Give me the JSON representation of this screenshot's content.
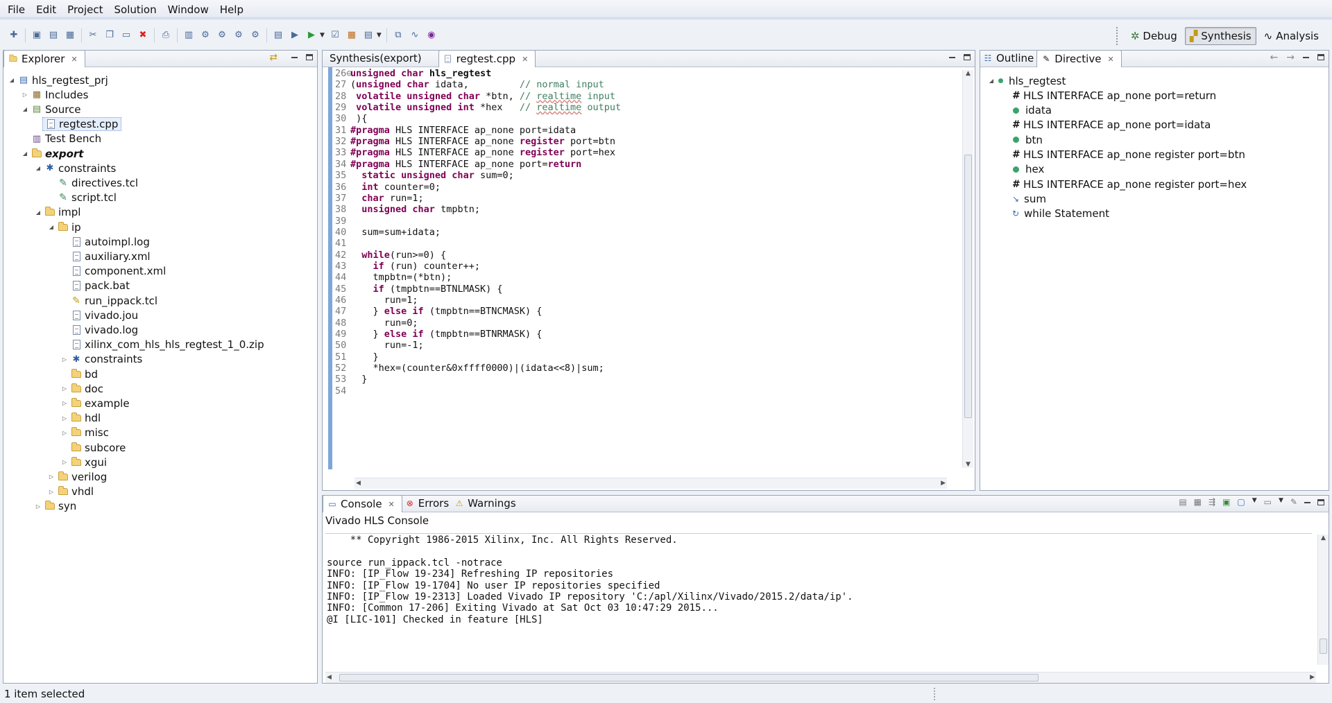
{
  "menu": [
    "File",
    "Edit",
    "Project",
    "Solution",
    "Window",
    "Help"
  ],
  "perspectives": {
    "debug": "Debug",
    "synthesis": "Synthesis",
    "analysis": "Analysis"
  },
  "explorer": {
    "tab": "Explorer",
    "items": [
      {
        "label": "hls_regtest_prj"
      },
      {
        "label": "Includes"
      },
      {
        "label": "Source"
      },
      {
        "label": "regtest.cpp"
      },
      {
        "label": "Test Bench"
      },
      {
        "label": "export"
      },
      {
        "label": "constraints"
      },
      {
        "label": "directives.tcl"
      },
      {
        "label": "script.tcl"
      },
      {
        "label": "impl"
      },
      {
        "label": "ip"
      },
      {
        "label": "autoimpl.log"
      },
      {
        "label": "auxiliary.xml"
      },
      {
        "label": "component.xml"
      },
      {
        "label": "pack.bat"
      },
      {
        "label": "run_ippack.tcl"
      },
      {
        "label": "vivado.jou"
      },
      {
        "label": "vivado.log"
      },
      {
        "label": "xilinx_com_hls_hls_regtest_1_0.zip"
      },
      {
        "label": "constraints"
      },
      {
        "label": "bd"
      },
      {
        "label": "doc"
      },
      {
        "label": "example"
      },
      {
        "label": "hdl"
      },
      {
        "label": "misc"
      },
      {
        "label": "subcore"
      },
      {
        "label": "xgui"
      },
      {
        "label": "verilog"
      },
      {
        "label": "vhdl"
      },
      {
        "label": "syn"
      }
    ]
  },
  "editor": {
    "tabs": [
      "Synthesis(export)",
      "regtest.cpp"
    ],
    "lines": [
      {
        "n": "26",
        "html": "<span class=\"kw\">unsigned char</span> <span class=\"bold\">hls_regtest</span>"
      },
      {
        "n": "27",
        "html": "(<span class=\"kw\">unsigned char</span> idata,         <span class=\"cm\">// normal input</span>"
      },
      {
        "n": "28",
        "html": " <span class=\"kw\">volatile unsigned char</span> *btn, <span class=\"cm\">// <span class=\"sq\">realtime</span> input</span>"
      },
      {
        "n": "29",
        "html": " <span class=\"kw\">volatile unsigned int</span> *hex   <span class=\"cm\">// <span class=\"sq\">realtime</span> output</span>"
      },
      {
        "n": "30",
        "html": " ){"
      },
      {
        "n": "31",
        "html": "<span class=\"kw\">#pragma</span> HLS INTERFACE ap_none port=idata"
      },
      {
        "n": "32",
        "html": "<span class=\"kw\">#pragma</span> HLS INTERFACE ap_none <span class=\"kw\">register</span> port=btn"
      },
      {
        "n": "33",
        "html": "<span class=\"kw\">#pragma</span> HLS INTERFACE ap_none <span class=\"kw\">register</span> port=hex"
      },
      {
        "n": "34",
        "html": "<span class=\"kw\">#pragma</span> HLS INTERFACE ap_none port=<span class=\"kw\">return</span>"
      },
      {
        "n": "35",
        "html": "  <span class=\"kw\">static unsigned char</span> sum=0;"
      },
      {
        "n": "36",
        "html": "  <span class=\"kw\">int</span> counter=0;"
      },
      {
        "n": "37",
        "html": "  <span class=\"kw\">char</span> run=1;"
      },
      {
        "n": "38",
        "html": "  <span class=\"kw\">unsigned char</span> tmpbtn;"
      },
      {
        "n": "39",
        "html": ""
      },
      {
        "n": "40",
        "html": "  sum=sum+idata;"
      },
      {
        "n": "41",
        "html": ""
      },
      {
        "n": "42",
        "html": "  <span class=\"kw\">while</span>(run>=0) {"
      },
      {
        "n": "43",
        "html": "    <span class=\"kw\">if</span> (run) counter++;"
      },
      {
        "n": "44",
        "html": "    tmpbtn=(*btn);"
      },
      {
        "n": "45",
        "html": "    <span class=\"kw\">if</span> (tmpbtn==BTNLMASK) {"
      },
      {
        "n": "46",
        "html": "      run=1;"
      },
      {
        "n": "47",
        "html": "    } <span class=\"kw\">else if</span> (tmpbtn==BTNCMASK) {"
      },
      {
        "n": "48",
        "html": "      run=0;"
      },
      {
        "n": "49",
        "html": "    } <span class=\"kw\">else if</span> (tmpbtn==BTNRMASK) {"
      },
      {
        "n": "50",
        "html": "      run=-1;"
      },
      {
        "n": "51",
        "html": "    }"
      },
      {
        "n": "52",
        "html": "    *hex=(counter&amp;0xffff0000)|(idata&lt;&lt;8)|sum;"
      },
      {
        "n": "53",
        "html": "  }"
      },
      {
        "n": "54",
        "html": ""
      }
    ]
  },
  "outline": {
    "tabs": [
      "Outline",
      "Directive"
    ],
    "root": "hls_regtest",
    "items": [
      {
        "kind": "hash",
        "label": "HLS INTERFACE ap_none port=return"
      },
      {
        "kind": "dot",
        "label": "idata"
      },
      {
        "kind": "hash",
        "label": "HLS INTERFACE ap_none port=idata"
      },
      {
        "kind": "dot",
        "label": "btn"
      },
      {
        "kind": "hash",
        "label": "HLS INTERFACE ap_none register port=btn"
      },
      {
        "kind": "dot",
        "label": "hex"
      },
      {
        "kind": "hash",
        "label": "HLS INTERFACE ap_none register port=hex"
      },
      {
        "kind": "var",
        "label": "sum"
      },
      {
        "kind": "loop",
        "label": "while Statement"
      }
    ]
  },
  "console": {
    "tabs": [
      "Console",
      "Errors",
      "Warnings"
    ],
    "title": "Vivado HLS Console",
    "lines": [
      "    ** Copyright 1986-2015 Xilinx, Inc. All Rights Reserved.",
      "",
      "source run_ippack.tcl -notrace",
      "INFO: [IP_Flow 19-234] Refreshing IP repositories",
      "INFO: [IP_Flow 19-1704] No user IP repositories specified",
      "INFO: [IP_Flow 19-2313] Loaded Vivado IP repository 'C:/apl/Xilinx/Vivado/2015.2/data/ip'.",
      "INFO: [Common 17-206] Exiting Vivado at Sat Oct 03 10:47:29 2015...",
      "@I [LIC-101] Checked in feature [HLS]"
    ]
  },
  "status": {
    "text": "1 item selected"
  }
}
